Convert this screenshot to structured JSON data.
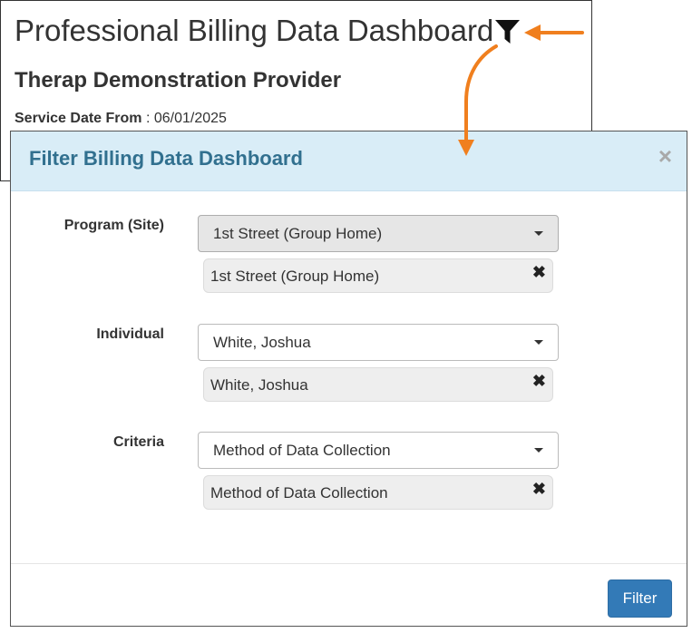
{
  "dashboard": {
    "title": "Professional Billing Data Dashboard",
    "provider": "Therap Demonstration Provider",
    "service_date_label": "Service Date From",
    "service_date_sep": ":",
    "service_date_value": "06/01/2025",
    "filter_icon": "funnel-icon"
  },
  "annotation": {
    "color": "#f07f1e"
  },
  "modal": {
    "title": "Filter Billing Data Dashboard",
    "close_glyph": "×",
    "fields": [
      {
        "label": "Program (Site)",
        "selected": "1st Street (Group Home)",
        "tag": "1st Street (Group Home)"
      },
      {
        "label": "Individual",
        "selected": "White, Joshua",
        "tag": "White, Joshua"
      },
      {
        "label": "Criteria",
        "selected": "Method of Data Collection",
        "tag": "Method of Data Collection"
      }
    ],
    "remove_glyph": "✖",
    "filter_button": "Filter",
    "colors": {
      "header_bg": "#d9edf7",
      "title": "#31708f",
      "button": "#337ab7"
    }
  }
}
